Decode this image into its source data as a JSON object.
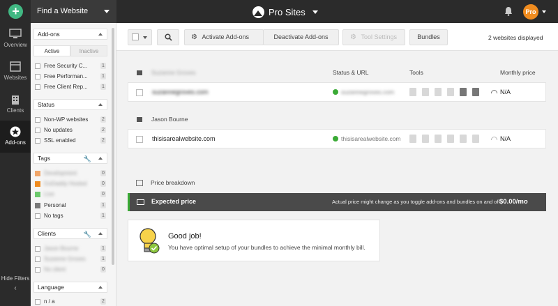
{
  "topbar": {
    "find_site_label": "Find a Website",
    "brand_name": "Pro Sites",
    "account_badge": "Pro"
  },
  "nav": {
    "items": [
      {
        "label": "Overview"
      },
      {
        "label": "Websites"
      },
      {
        "label": "Clients"
      },
      {
        "label": "Add-ons"
      }
    ],
    "hide_filters": "Hide Filters"
  },
  "filters": {
    "addons": {
      "title": "Add-ons",
      "tabs": [
        "Active",
        "Inactive"
      ],
      "items": [
        {
          "label": "Free Security C...",
          "count": "1"
        },
        {
          "label": "Free Performan...",
          "count": "1"
        },
        {
          "label": "Free Client Rep...",
          "count": "1"
        }
      ]
    },
    "status": {
      "title": "Status",
      "items": [
        {
          "label": "Non-WP websites",
          "count": "2"
        },
        {
          "label": "No updates",
          "count": "2"
        },
        {
          "label": "SSL enabled",
          "count": "2"
        }
      ]
    },
    "tags": {
      "title": "Tags",
      "items": [
        {
          "label": "Development",
          "count": "0",
          "color": "#f0a66a"
        },
        {
          "label": "GoDaddy Hosted",
          "count": "0",
          "color": "#f08c1f"
        },
        {
          "label": "Live",
          "count": "0",
          "color": "#6cc96c"
        },
        {
          "label": "Personal",
          "count": "1",
          "color": "#7a7a7a"
        },
        {
          "label": "No tags",
          "count": "1",
          "color": ""
        }
      ]
    },
    "clients": {
      "title": "Clients",
      "items": [
        {
          "label": "Jason Bourne",
          "count": "1"
        },
        {
          "label": "Suzanne Groves",
          "count": "1"
        },
        {
          "label": "No client",
          "count": "0"
        }
      ]
    },
    "language": {
      "title": "Language",
      "items": [
        {
          "label": "n / a",
          "count": "2"
        }
      ]
    }
  },
  "toolbar": {
    "activate_label": "Activate  Add-ons",
    "deactivate_label": "Deactivate  Add-ons",
    "tool_settings_label": "Tool Settings",
    "bundles_label": "Bundles",
    "displayed": "2 websites displayed"
  },
  "table": {
    "columns": [
      "Status & URL",
      "Tools",
      "Monthly price"
    ],
    "groups": [
      {
        "owner": "Suzanne Groves",
        "site": {
          "name": "suzannegroves.com",
          "url": "suzannegroves.com",
          "price": "N/A"
        }
      },
      {
        "owner": "Jason Bourne",
        "site": {
          "name": "thisisarealwebsite.com",
          "url": "thisisarealwebsite.com",
          "price": "N/A"
        }
      }
    ]
  },
  "price_breakdown": {
    "title": "Price breakdown",
    "expected_label": "Expected price",
    "note": "Actual price might change as you toggle add-ons and bundles on and off.",
    "amount": "$0.00/mo"
  },
  "goodjob": {
    "title": "Good job!",
    "message": "You have optimal setup of your bundles to achieve the minimal monthly bill."
  },
  "colors": {
    "accent_green": "#3aaa35",
    "brand_orange": "#f08c1f",
    "topbar": "#2b2b2b"
  }
}
